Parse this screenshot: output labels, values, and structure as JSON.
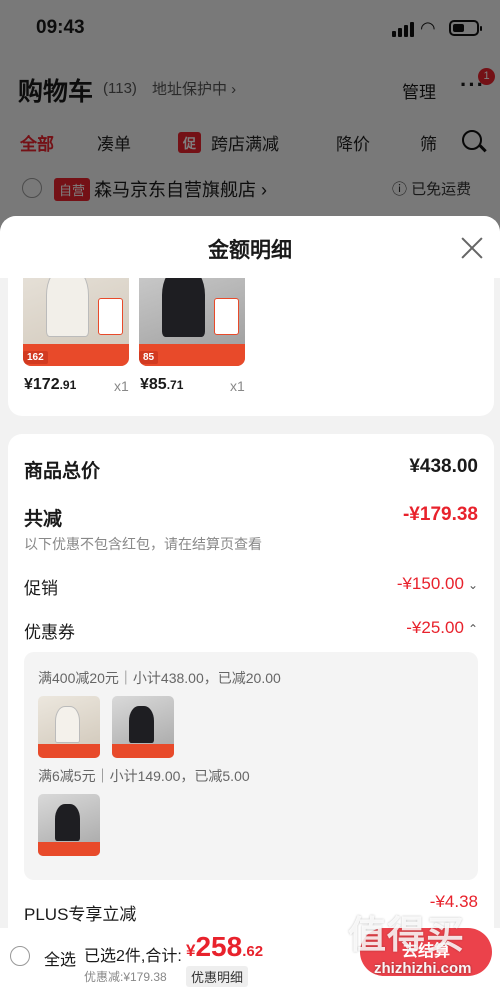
{
  "status_bar": {
    "time": "09:43"
  },
  "cart": {
    "title": "购物车",
    "count": "(113)",
    "address": "地址保护中 ›",
    "manage": "管理",
    "more": "···",
    "notification_count": "1"
  },
  "tabs": [
    {
      "label": "全部"
    },
    {
      "label": "凑单"
    },
    {
      "tag": "促",
      "label": "跨店满减"
    },
    {
      "label": "降价"
    },
    {
      "label": "筛"
    }
  ],
  "shop": {
    "tag": "自营",
    "name": "森马京东自营旗舰店 ›",
    "shipping": "ⓘ 已免运费"
  },
  "sheet": {
    "title": "金额明细",
    "products": [
      {
        "price_main": "¥172",
        "price_dec": ".91",
        "qty": "x1",
        "promo_num": "162"
      },
      {
        "price_main": "¥85",
        "price_dec": ".71",
        "qty": "x1",
        "promo_num": "85"
      }
    ],
    "total_label": "商品总价",
    "total_value": "¥438.00",
    "reduce_label": "共减",
    "reduce_value": "-¥179.38",
    "reduce_hint": "以下优惠不包含红包，请在结算页查看",
    "promo_label": "促销",
    "promo_value": "-¥150.00",
    "coupon_label": "优惠券",
    "coupon_value": "-¥25.00",
    "coupons": [
      {
        "text": "满400减20元｜小计438.00，已减20.00"
      },
      {
        "text": "满6减5元｜小计149.00，已减5.00"
      }
    ],
    "plus_label": "PLUS专享立减",
    "plus_value": "-¥4.38"
  },
  "bottom": {
    "select_all": "全选",
    "selected": "已选2件,合计:",
    "currency": "¥",
    "total_main": "258",
    "total_dec": ".62",
    "discount": "优惠减:¥179.38",
    "detail_btn": "优惠明细",
    "checkout": "去结算"
  },
  "watermark": {
    "text": "值得买",
    "url": "zhizhizhi.com"
  },
  "colors": {
    "accent": "#e8222c",
    "promo_band": "#e84a2a"
  }
}
